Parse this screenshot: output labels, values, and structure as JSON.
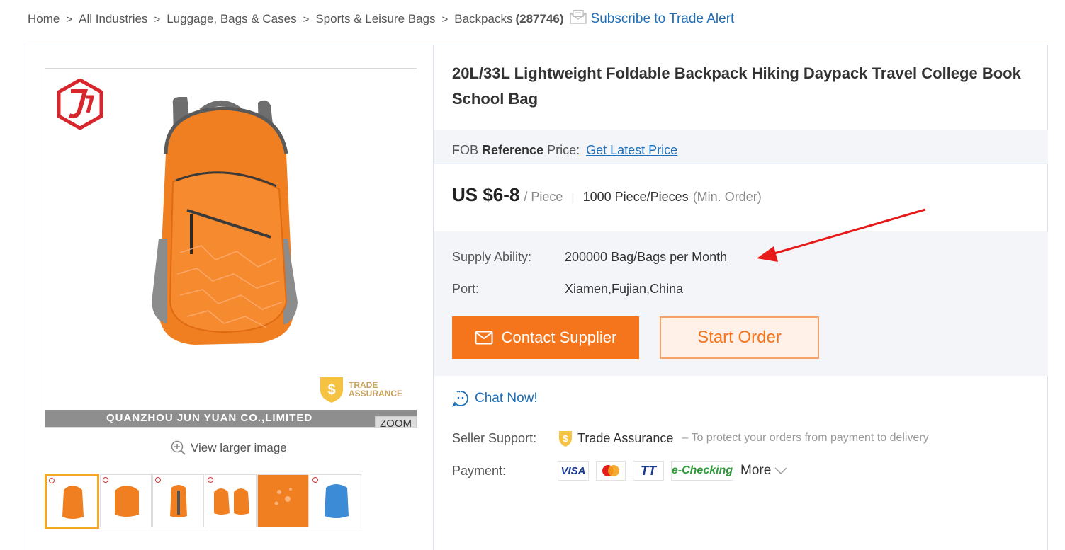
{
  "breadcrumb": {
    "items": [
      "Home",
      "All Industries",
      "Luggage, Bags & Cases",
      "Sports & Leisure Bags",
      "Backpacks"
    ],
    "separator": ">",
    "count": "(287746)",
    "subscribe_label": "Subscribe to Trade Alert"
  },
  "gallery": {
    "watermark": "QUANZHOU JUN YUAN CO.,LIMITED",
    "trade_assurance_badge": [
      "TRADE",
      "ASSURANCE"
    ],
    "zoom_label": "ZOOM",
    "view_larger_label": "View larger image",
    "thumbnails": [
      {
        "color": "#f07f22",
        "selected": true
      },
      {
        "color": "#f07f22",
        "selected": false
      },
      {
        "color": "#f07f22",
        "selected": false
      },
      {
        "color": "#f07f22",
        "selected": false
      },
      {
        "color": "#f07f22",
        "selected": false
      },
      {
        "color": "#3b8bd6",
        "selected": false
      }
    ]
  },
  "product": {
    "title": "20L/33L Lightweight Foldable Backpack Hiking Daypack Travel College Book School Bag",
    "fob_prefix": "FOB",
    "fob_bold": "Reference",
    "fob_suffix": "Price:",
    "fob_link": "Get Latest Price",
    "price": "US $6-8",
    "price_unit": "/ Piece",
    "moq": "1000 Piece/Pieces",
    "moq_label": "(Min. Order)",
    "supply_label": "Supply Ability:",
    "supply_value": "200000 Bag/Bags per Month",
    "port_label": "Port:",
    "port_value": "Xiamen,Fujian,China"
  },
  "actions": {
    "contact_supplier": "Contact Supplier",
    "start_order": "Start Order",
    "chat_now": "Chat Now!"
  },
  "seller_support": {
    "label": "Seller Support:",
    "trade_assurance": "Trade Assurance",
    "note": "– To protect your orders from payment to delivery"
  },
  "payment": {
    "label": "Payment:",
    "methods": [
      "VISA",
      "",
      "TT",
      "e-Checking"
    ],
    "more_label": "More"
  },
  "colors": {
    "accent_orange": "#f5751d",
    "link_blue": "#1f6fb8",
    "annotation_red": "#e81b1b"
  }
}
